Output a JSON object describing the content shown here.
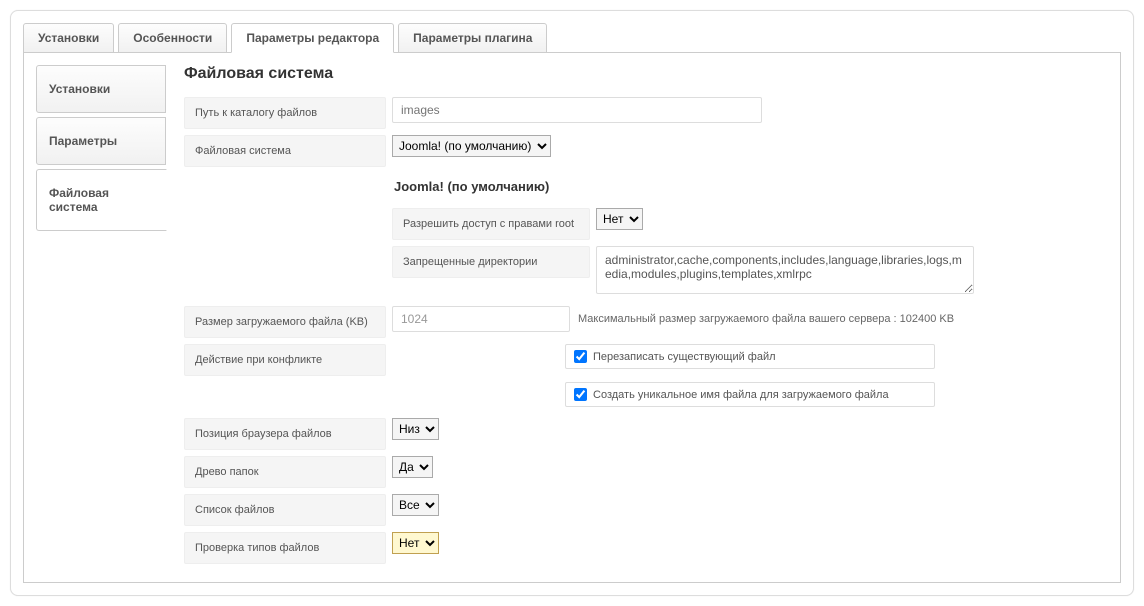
{
  "topTabs": [
    {
      "label": "Установки"
    },
    {
      "label": "Особенности"
    },
    {
      "label": "Параметры редактора"
    },
    {
      "label": "Параметры плагина"
    }
  ],
  "sideTabs": [
    {
      "label": "Установки"
    },
    {
      "label": "Параметры"
    },
    {
      "label": "Файловая система"
    }
  ],
  "heading": "Файловая система",
  "fields": {
    "pathLabel": "Путь к каталогу файлов",
    "pathPlaceholder": "images",
    "fsLabel": "Файловая система",
    "fsValue": "Joomla! (по умолчанию)",
    "subHeading": "Joomla! (по умолчанию)",
    "rootLabel": "Разрешить доступ с правами root",
    "rootValue": "Нет",
    "forbiddenLabel": "Запрещенные директории",
    "forbiddenValue": "administrator,cache,components,includes,language,libraries,logs,media,modules,plugins,templates,xmlrpc",
    "sizeLabel": "Размер загружаемого файла (KB)",
    "sizeValue": "1024",
    "sizeHint": "Максимальный размер загружаемого файла вашего сервера : 102400 KB",
    "conflictLabel": "Действие при конфликте",
    "conflictOpt1": "Перезаписать существующий файл",
    "conflictOpt2": "Создать уникальное имя файла для загружаемого файла",
    "browserPosLabel": "Позиция браузера файлов",
    "browserPosValue": "Низ",
    "treeLabel": "Древо папок",
    "treeValue": "Да",
    "listLabel": "Список файлов",
    "listValue": "Все",
    "typecheckLabel": "Проверка типов файлов",
    "typecheckValue": "Нет"
  }
}
